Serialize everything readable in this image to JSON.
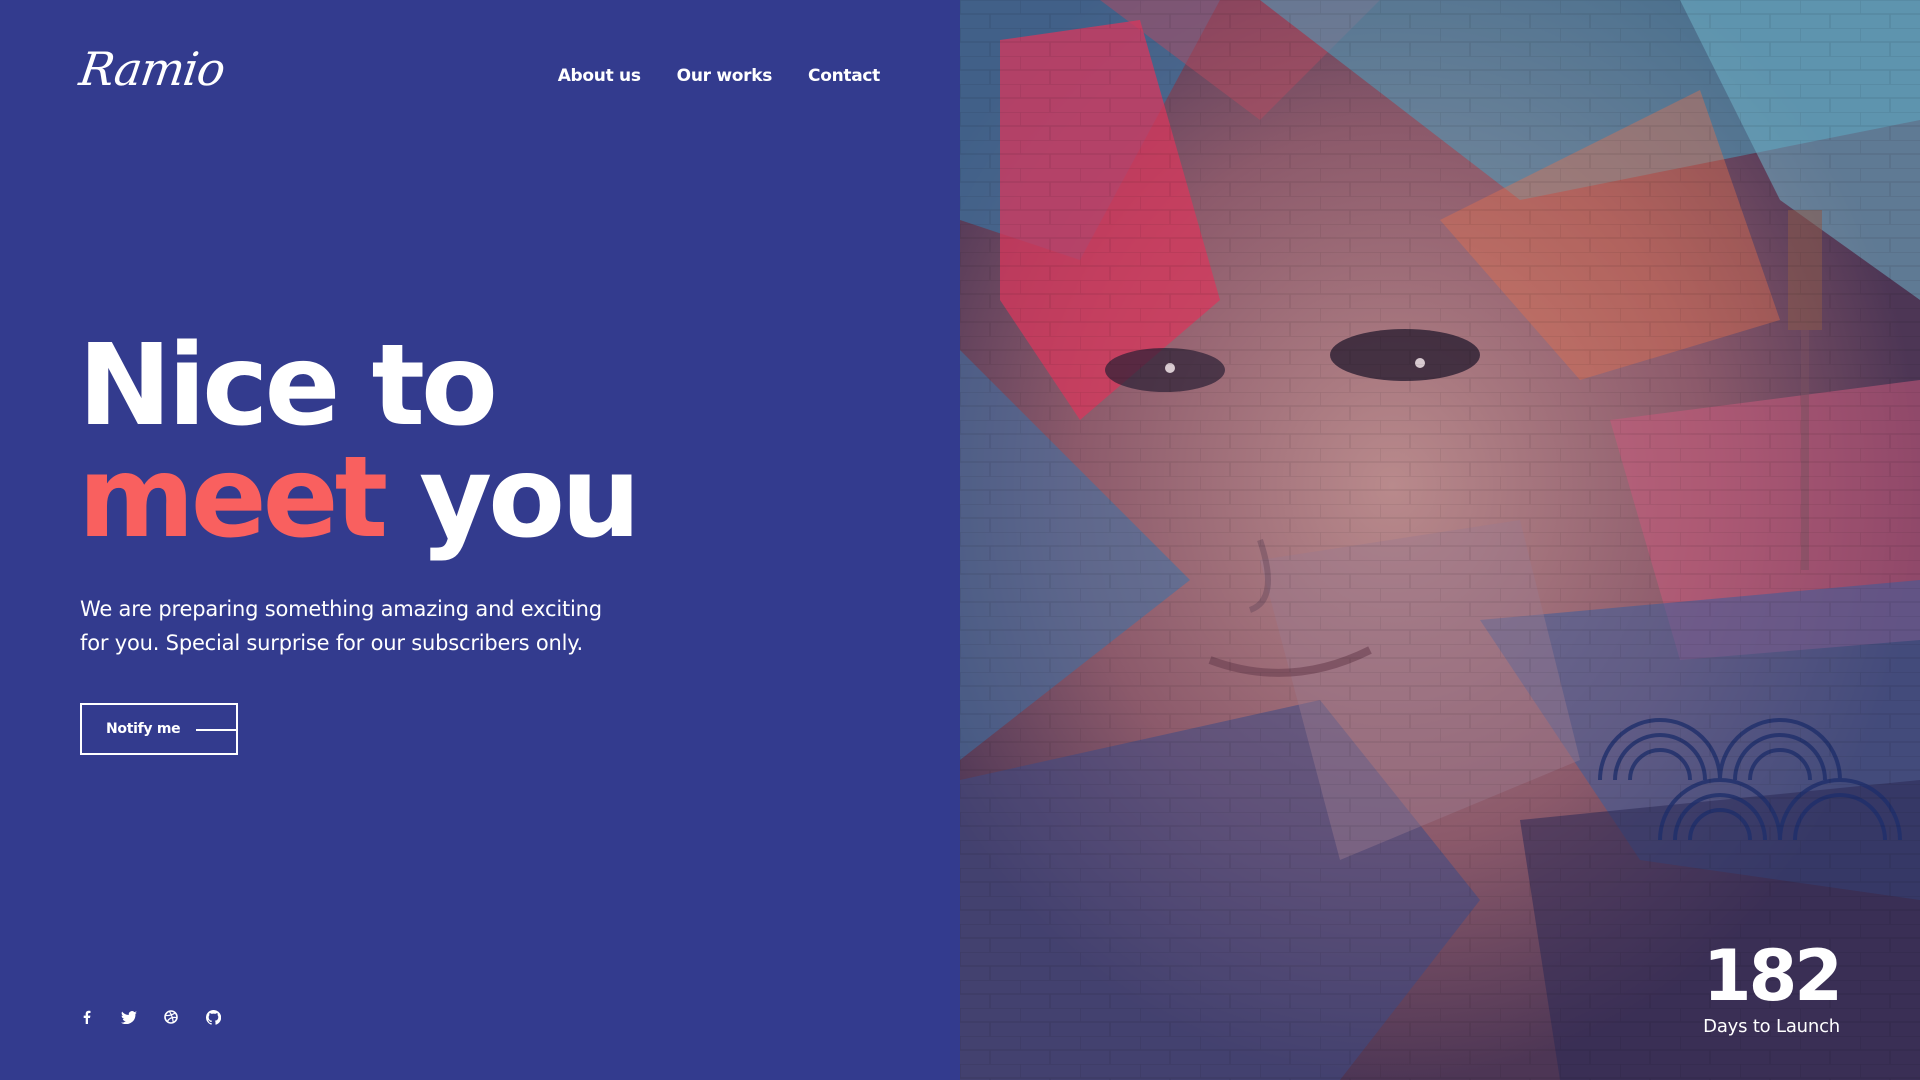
{
  "brand": {
    "logo_text": "Ramio"
  },
  "nav": {
    "items": [
      {
        "label": "About us"
      },
      {
        "label": "Our works"
      },
      {
        "label": "Contact"
      }
    ]
  },
  "hero": {
    "headline_line1": "Nice to",
    "headline_accent": "meet",
    "headline_end": "you",
    "description_line1": "We are preparing something amazing and exciting",
    "description_line2": "for you. Special surprise for our subscribers only.",
    "cta_label": "Notify me"
  },
  "socials": {
    "icons": [
      "facebook-icon",
      "twitter-icon",
      "dribbble-icon",
      "github-icon"
    ]
  },
  "countdown": {
    "value": "182",
    "label": "Days to Launch"
  },
  "colors": {
    "panel_background": "#333b8e",
    "accent": "#f9605f",
    "text": "#ffffff"
  }
}
